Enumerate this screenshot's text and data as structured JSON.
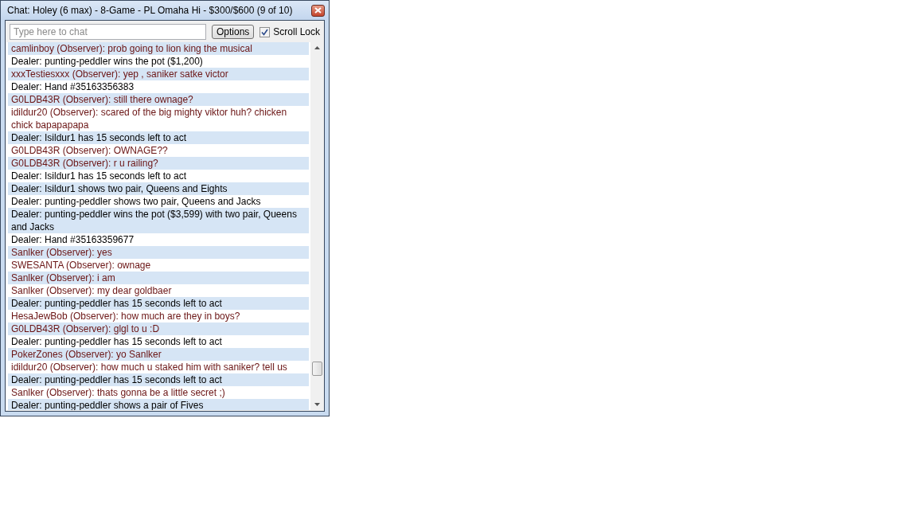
{
  "window": {
    "title": "Chat: Holey (6 max) - 8-Game - PL Omaha Hi - $300/$600 (9 of 10)"
  },
  "chat_input": {
    "placeholder": "Type here to chat"
  },
  "options_button": "Options",
  "scroll_lock": {
    "label": "Scroll Lock",
    "checked": true
  },
  "messages": [
    {
      "kind": "observer",
      "text": "camlinboy (Observer): prob going to lion king the musical"
    },
    {
      "kind": "dealer",
      "text": "Dealer: punting-peddler wins the pot ($1,200)"
    },
    {
      "kind": "observer",
      "text": "xxxTestiesxxx (Observer): yep , saniker satke victor"
    },
    {
      "kind": "dealer",
      "text": "Dealer: Hand #35163356383"
    },
    {
      "kind": "observer",
      "text": "G0LDB43R (Observer): still there ownage?"
    },
    {
      "kind": "observer",
      "text": "idildur20 (Observer): scared of the big mighty viktor huh? chicken chick bapapapapa"
    },
    {
      "kind": "dealer",
      "text": "Dealer: Isildur1 has 15 seconds left to act"
    },
    {
      "kind": "observer",
      "text": "G0LDB43R (Observer): OWNAGE??"
    },
    {
      "kind": "observer",
      "text": "G0LDB43R (Observer): r u railing?"
    },
    {
      "kind": "dealer",
      "text": "Dealer: Isildur1 has 15 seconds left to act"
    },
    {
      "kind": "dealer",
      "text": "Dealer: Isildur1 shows two pair, Queens and Eights"
    },
    {
      "kind": "dealer",
      "text": "Dealer: punting-peddler shows two pair, Queens and Jacks"
    },
    {
      "kind": "dealer",
      "text": "Dealer: punting-peddler wins the pot ($3,599) with two pair, Queens and Jacks"
    },
    {
      "kind": "dealer",
      "text": "Dealer: Hand #35163359677"
    },
    {
      "kind": "observer",
      "text": "Sanlker (Observer): yes"
    },
    {
      "kind": "observer",
      "text": "SWESANTA (Observer): ownage"
    },
    {
      "kind": "observer",
      "text": "Sanlker (Observer): i am"
    },
    {
      "kind": "observer",
      "text": "Sanlker (Observer): my dear goldbaer"
    },
    {
      "kind": "dealer",
      "text": "Dealer: punting-peddler has 15 seconds left to act"
    },
    {
      "kind": "observer",
      "text": "HesaJewBob (Observer): how much are they in boys?"
    },
    {
      "kind": "observer",
      "text": "G0LDB43R (Observer): glgl to u :D"
    },
    {
      "kind": "dealer",
      "text": "Dealer: punting-peddler has 15 seconds left to act"
    },
    {
      "kind": "observer",
      "text": "PokerZones (Observer): yo Sanlker"
    },
    {
      "kind": "observer",
      "text": "idildur20 (Observer): how much u staked him with saniker? tell us"
    },
    {
      "kind": "dealer",
      "text": "Dealer: punting-peddler has 15 seconds left to act"
    },
    {
      "kind": "observer",
      "text": "Sanlker (Observer): thats gonna be a little secret ;)"
    },
    {
      "kind": "dealer",
      "text": "Dealer: punting-peddler shows a pair of Fives"
    }
  ]
}
